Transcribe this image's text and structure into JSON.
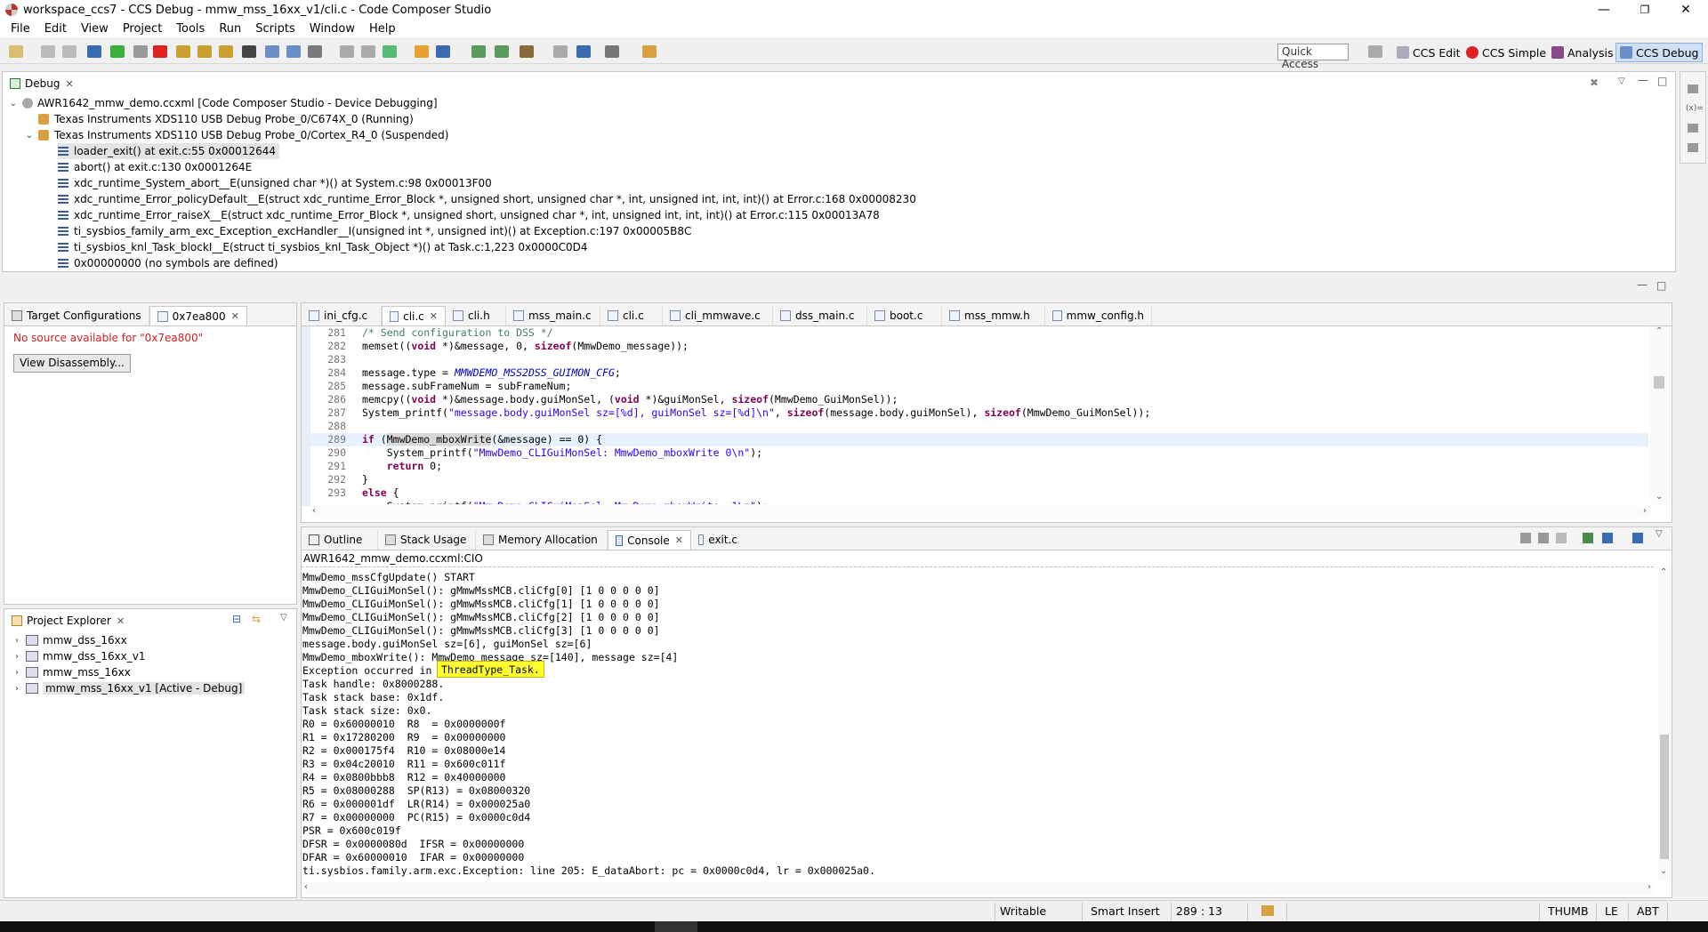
{
  "window": {
    "title": "workspace_ccs7 - CCS Debug - mmw_mss_16xx_v1/cli.c - Code Composer Studio",
    "minimize": "—",
    "restore": "❐",
    "close": "✕"
  },
  "menu": [
    "File",
    "Edit",
    "View",
    "Project",
    "Tools",
    "Run",
    "Scripts",
    "Window",
    "Help"
  ],
  "toolbar": {
    "quick_access": "Quick Access",
    "perspectives": [
      "CCS Edit",
      "CCS Simple",
      "Analysis",
      "CCS Debug"
    ]
  },
  "debug": {
    "tab_label": "Debug",
    "tree": [
      {
        "label": "AWR1642_mmw_demo.ccxml [Code Composer Studio - Device Debugging]",
        "level": 0
      },
      {
        "label": "Texas Instruments XDS110 USB Debug Probe_0/C674X_0 (Running)",
        "level": 1
      },
      {
        "label": "Texas Instruments XDS110 USB Debug Probe_0/Cortex_R4_0 (Suspended)",
        "level": 1
      },
      {
        "label": "loader_exit() at exit.c:55 0x00012644",
        "level": 2,
        "selected": true
      },
      {
        "label": "abort() at exit.c:130 0x0001264E",
        "level": 2
      },
      {
        "label": "xdc_runtime_System_abort__E(unsigned char *)() at System.c:98 0x00013F00",
        "level": 2
      },
      {
        "label": "xdc_runtime_Error_policyDefault__E(struct xdc_runtime_Error_Block *, unsigned short, unsigned char *, int, unsigned int, int, int)() at Error.c:168 0x00008230",
        "level": 2
      },
      {
        "label": "xdc_runtime_Error_raiseX__E(struct xdc_runtime_Error_Block *, unsigned short, unsigned char *, int, unsigned int, int, int)() at Error.c:115 0x00013A78",
        "level": 2
      },
      {
        "label": "ti_sysbios_family_arm_exc_Exception_excHandler__I(unsigned int *, unsigned int)() at Exception.c:197 0x00005B8C",
        "level": 2
      },
      {
        "label": "ti_sysbios_knl_Task_blockI__E(struct ti_sysbios_knl_Task_Object *)() at Task.c:1,223 0x0000C0D4",
        "level": 2
      },
      {
        "label": "0x00000000  (no symbols are defined)",
        "level": 2
      }
    ]
  },
  "left_top": {
    "tabs": [
      "Target Configurations",
      "0x7ea800"
    ],
    "message": "No source available for \"0x7ea800\"",
    "button": "View Disassembly..."
  },
  "project_explorer": {
    "tab_label": "Project Explorer",
    "items": [
      "mmw_dss_16xx",
      "mmw_dss_16xx_v1",
      "mmw_mss_16xx",
      "mmw_mss_16xx_v1  [Active - Debug]"
    ]
  },
  "editor": {
    "tabs": [
      "ini_cfg.c",
      "cli.c",
      "cli.h",
      "mss_main.c",
      "cli.c",
      "cli_mmwave.c",
      "dss_main.c",
      "boot.c",
      "mss_mmw.h",
      "mmw_config.h"
    ],
    "line_numbers": [
      "281",
      "282",
      "283",
      "284",
      "285",
      "286",
      "287",
      "288",
      "289",
      "290",
      "291",
      "292",
      "293"
    ]
  },
  "bottom": {
    "tabs": [
      "Outline",
      "Stack Usage",
      "Memory Allocation",
      "Console",
      "exit.c"
    ],
    "console_title": "AWR1642_mmw_demo.ccxml:CIO",
    "console_lines": [
      "MmwDemo_mssCfgUpdate() START",
      "MmwDemo_CLIGuiMonSel(): gMmwMssMCB.cliCfg[0] [1 0 0 0 0 0]",
      "MmwDemo_CLIGuiMonSel(): gMmwMssMCB.cliCfg[1] [1 0 0 0 0 0]",
      "MmwDemo_CLIGuiMonSel(): gMmwMssMCB.cliCfg[2] [1 0 0 0 0 0]",
      "MmwDemo_CLIGuiMonSel(): gMmwMssMCB.cliCfg[3] [1 0 0 0 0 0]",
      "message.body.guiMonSel sz=[6], guiMonSel sz=[6]",
      "MmwDemo_mboxWrite(): MmwDemo_message sz=[140], message sz=[4]",
      "Exception occurred in ",
      "Task handle: 0x8000288.",
      "Task stack base: 0x1df.",
      "Task stack size: 0x0.",
      "R0 = 0x60000010  R8  = 0x0000000f",
      "R1 = 0x17280200  R9  = 0x00000000",
      "R2 = 0x000175f4  R10 = 0x08000e14",
      "R3 = 0x04c20010  R11 = 0x600c011f",
      "R4 = 0x0800bbb8  R12 = 0x40000000",
      "R5 = 0x08000288  SP(R13) = 0x08000320",
      "R6 = 0x000001df  LR(R14) = 0x000025a0",
      "R7 = 0x00000000  PC(R15) = 0x0000c0d4",
      "PSR = 0x600c019f",
      "DFSR = 0x0000080d  IFSR = 0x00000000",
      "DFAR = 0x60000010  IFAR = 0x00000000",
      "ti.sysbios.family.arm.exc.Exception: line 205: E_dataAbort: pc = 0x0000c0d4, lr = 0x000025a0."
    ],
    "tooltip": "ThreadType_Task."
  },
  "status": {
    "writable": "Writable",
    "insert_mode": "Smart Insert",
    "position": "289 : 13",
    "thumb": "THUMB",
    "endian": "LE",
    "abt": "ABT"
  }
}
